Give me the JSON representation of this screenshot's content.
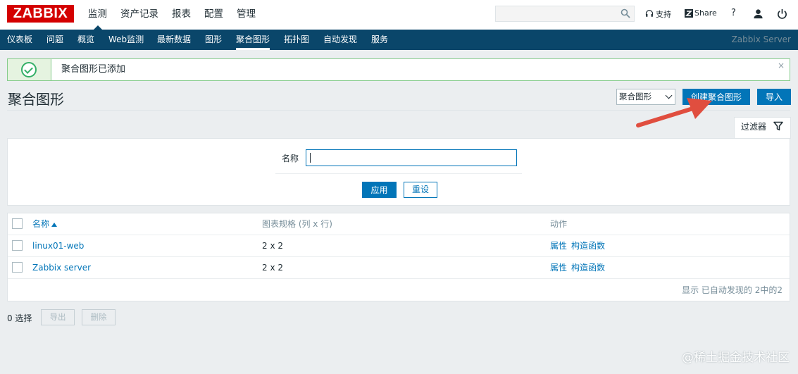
{
  "header": {
    "logo": "ZABBIX",
    "menu": [
      {
        "label": "监测",
        "active": true
      },
      {
        "label": "资产记录",
        "active": false
      },
      {
        "label": "报表",
        "active": false
      },
      {
        "label": "配置",
        "active": false
      },
      {
        "label": "管理",
        "active": false
      }
    ],
    "search_placeholder": "",
    "support_label": "支持",
    "share_label": "Share",
    "help_label": "?"
  },
  "subnav": {
    "items": [
      "仪表板",
      "问题",
      "概览",
      "Web监测",
      "最新数据",
      "图形",
      "聚合图形",
      "拓扑图",
      "自动发现",
      "服务"
    ],
    "active_index": 6,
    "server_name": "Zabbix Server"
  },
  "message": {
    "text": "聚合图形已添加",
    "close": "×"
  },
  "page": {
    "title": "聚合图形",
    "select_value": "聚合图形",
    "create_button": "创建聚合图形",
    "import_button": "导入"
  },
  "filter": {
    "tab_label": "过滤器",
    "name_label": "名称",
    "name_value": "",
    "apply_button": "应用",
    "reset_button": "重设"
  },
  "table": {
    "columns": [
      "名称",
      "图表规格 (列 x 行)",
      "动作"
    ],
    "rows": [
      {
        "name": "linux01-web",
        "dimensions": "2 x 2",
        "action1": "属性",
        "action2": "构造函数"
      },
      {
        "name": "Zabbix server",
        "dimensions": "2 x 2",
        "action1": "属性",
        "action2": "构造函数"
      }
    ],
    "footer": "显示 已自动发现的 2中的2"
  },
  "bottom": {
    "selected": "0 选择",
    "export_button": "导出",
    "delete_button": "删除"
  },
  "watermark": "@稀土掘金技术社区",
  "colors": {
    "brand_red": "#d40000",
    "nav_blue": "#0a466a",
    "accent_blue": "#0275b8",
    "success_green": "#34af67",
    "arrow_red": "#e04e3f"
  }
}
